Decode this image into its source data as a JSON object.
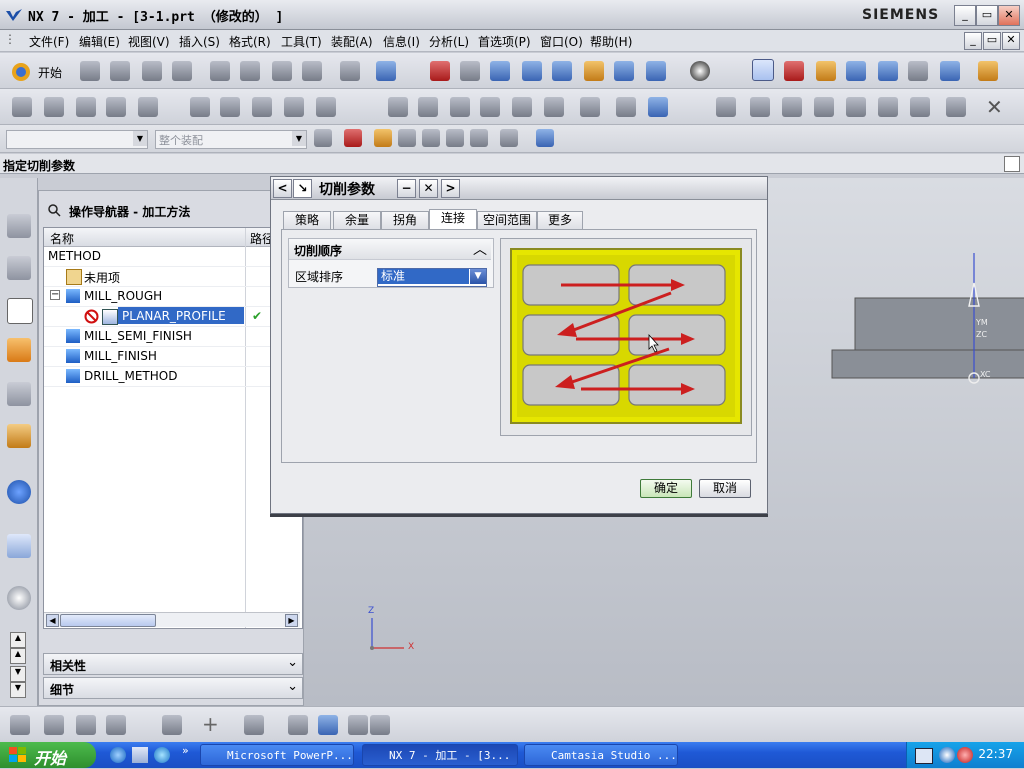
{
  "window": {
    "title": "NX 7 - 加工 - [3-1.prt （修改的） ]",
    "brand": "SIEMENS",
    "controls": {
      "minimize": "_",
      "maximize": "▭",
      "close": "✕"
    }
  },
  "menubar": {
    "items": [
      "文件(F)",
      "编辑(E)",
      "视图(V)",
      "插入(S)",
      "格式(R)",
      "工具(T)",
      "装配(A)",
      "信息(I)",
      "分析(L)",
      "首选项(P)",
      "窗口(O)",
      "帮助(H)"
    ]
  },
  "toolbar": {
    "start_label": "开始",
    "filter_select": "",
    "assembly_select": "整个装配"
  },
  "prompt": {
    "text": "指定切削参数"
  },
  "navigator": {
    "title": "操作导航器 - 加工方法",
    "columns": [
      "名称",
      "路径"
    ],
    "rows": [
      {
        "label": "METHOD"
      },
      {
        "label": "未用项"
      },
      {
        "label": "MILL_ROUGH"
      },
      {
        "label": "PLANAR_PROFILE",
        "status": "✔"
      },
      {
        "label": "MILL_SEMI_FINISH"
      },
      {
        "label": "MILL_FINISH"
      },
      {
        "label": "DRILL_METHOD"
      }
    ],
    "sections": [
      "相关性",
      "细节"
    ]
  },
  "dialog": {
    "title": "切削参数",
    "tabs": [
      "策略",
      "余量",
      "拐角",
      "连接",
      "空间范围",
      "更多"
    ],
    "active_tab": "连接",
    "group_title": "切削顺序",
    "field_label": "区域排序",
    "field_value": "标准",
    "ok": "确定",
    "cancel": "取消",
    "colors": {
      "highlight": "#e6e600",
      "arrow": "#cc1f1f"
    }
  },
  "viewport": {
    "axis_labels": {
      "z": "Z",
      "x": "X",
      "zm": "YM",
      "zc": "ZC",
      "xc": "XC"
    }
  },
  "taskbar": {
    "start": "开始",
    "tasks": [
      "Microsoft PowerP...",
      "NX 7 - 加工 - [3...",
      "Camtasia Studio ..."
    ],
    "clock": "22:37"
  }
}
